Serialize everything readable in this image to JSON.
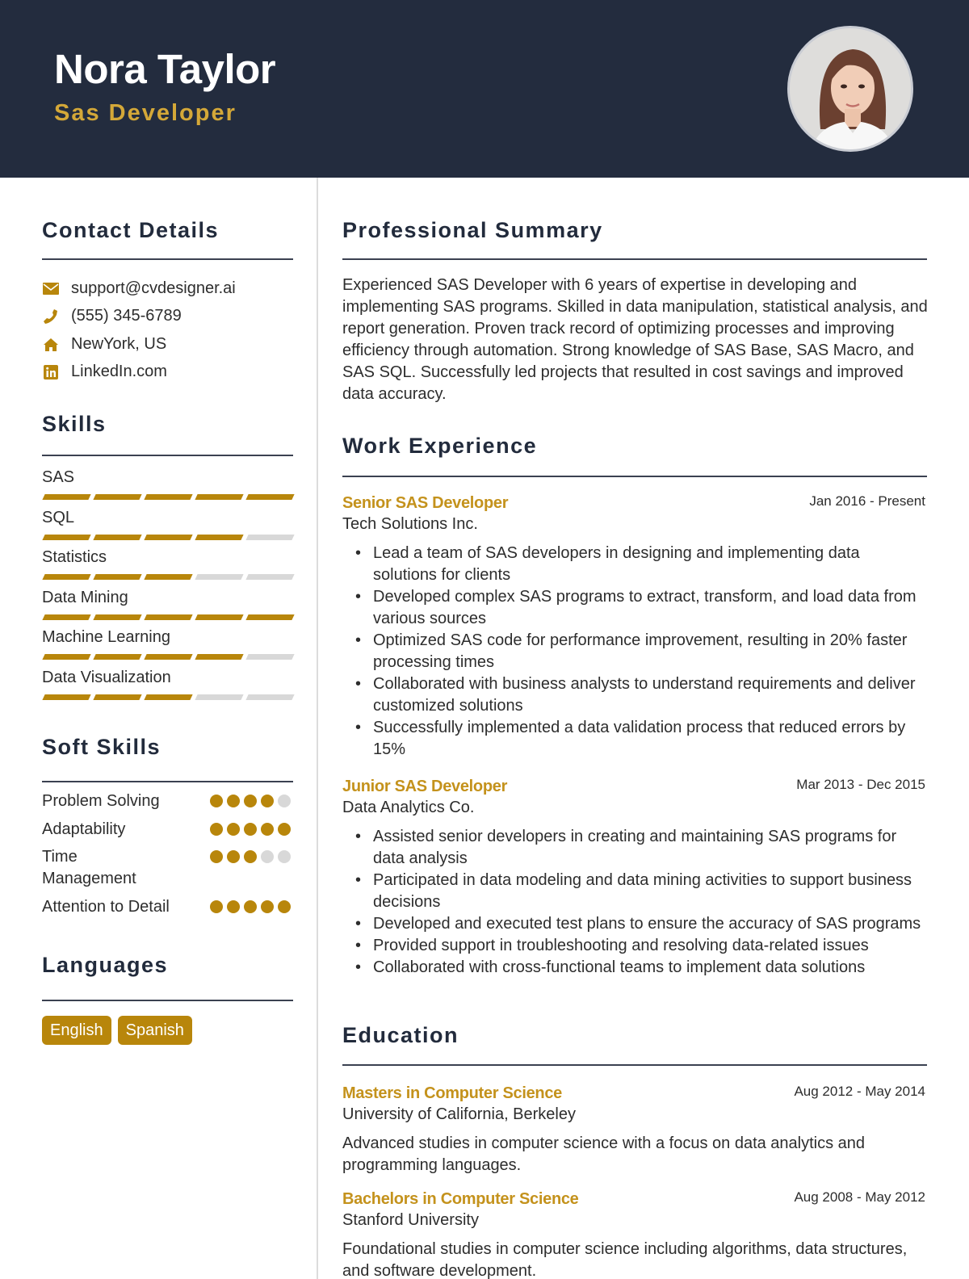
{
  "header": {
    "name": "Nora Taylor",
    "title": "Sas Developer",
    "photo_alt": "Profile photo"
  },
  "colors": {
    "header_bg": "#232c3e",
    "accent": "#b8860b",
    "title_gold": "#d4a838",
    "inactive": "#d8d8d8"
  },
  "contact": {
    "heading": "Contact Details",
    "items": [
      {
        "icon": "envelope-icon",
        "text": "support@cvdesigner.ai"
      },
      {
        "icon": "phone-icon",
        "text": "(555) 345-6789"
      },
      {
        "icon": "home-icon",
        "text": "NewYork, US"
      },
      {
        "icon": "linkedin-icon",
        "text": "LinkedIn.com"
      }
    ]
  },
  "skills": {
    "heading": "Skills",
    "items": [
      {
        "name": "SAS",
        "level": 5,
        "max": 5
      },
      {
        "name": "SQL",
        "level": 4,
        "max": 5
      },
      {
        "name": "Statistics",
        "level": 3,
        "max": 5
      },
      {
        "name": "Data Mining",
        "level": 5,
        "max": 5
      },
      {
        "name": "Machine Learning",
        "level": 4,
        "max": 5
      },
      {
        "name": "Data Visualization",
        "level": 3,
        "max": 5
      }
    ]
  },
  "soft_skills": {
    "heading": "Soft Skills",
    "items": [
      {
        "name": "Problem Solving",
        "level": 4,
        "max": 5
      },
      {
        "name": "Adaptability",
        "level": 5,
        "max": 5
      },
      {
        "name": "Time Management",
        "level": 3,
        "max": 5
      },
      {
        "name": "Attention to Detail",
        "level": 5,
        "max": 5
      }
    ]
  },
  "languages": {
    "heading": "Languages",
    "items": [
      "English",
      "Spanish"
    ]
  },
  "summary": {
    "heading": "Professional Summary",
    "text": "Experienced SAS Developer with 6 years of expertise in developing and implementing SAS programs. Skilled in data manipulation, statistical analysis, and report generation. Proven track record of optimizing processes and improving efficiency through automation. Strong knowledge of SAS Base, SAS Macro, and SAS SQL. Successfully led projects that resulted in cost savings and improved data accuracy."
  },
  "experience": {
    "heading": "Work Experience",
    "jobs": [
      {
        "title": "Senior SAS Developer",
        "dates": "Jan 2016 - Present",
        "company": "Tech Solutions Inc.",
        "bullets": [
          "Lead a team of SAS developers in designing and implementing data solutions for clients",
          "Developed complex SAS programs to extract, transform, and load data from various sources",
          "Optimized SAS code for performance improvement, resulting in 20% faster processing times",
          "Collaborated with business analysts to understand requirements and deliver customized solutions",
          "Successfully implemented a data validation process that reduced errors by 15%"
        ]
      },
      {
        "title": "Junior SAS Developer",
        "dates": "Mar 2013 - Dec 2015",
        "company": "Data Analytics Co.",
        "bullets": [
          "Assisted senior developers in creating and maintaining SAS programs for data analysis",
          "Participated in data modeling and data mining activities to support business decisions",
          "Developed and executed test plans to ensure the accuracy of SAS programs",
          "Provided support in troubleshooting and resolving data-related issues",
          "Collaborated with cross-functional teams to implement data solutions"
        ]
      }
    ]
  },
  "education": {
    "heading": "Education",
    "items": [
      {
        "degree": "Masters in Computer Science",
        "dates": "Aug 2012 - May 2014",
        "school": "University of California, Berkeley",
        "description": "Advanced studies in computer science with a focus on data analytics and programming languages."
      },
      {
        "degree": "Bachelors in Computer Science",
        "dates": "Aug 2008 - May 2012",
        "school": "Stanford University",
        "description": "Foundational studies in computer science including algorithms, data structures, and software development."
      }
    ]
  }
}
